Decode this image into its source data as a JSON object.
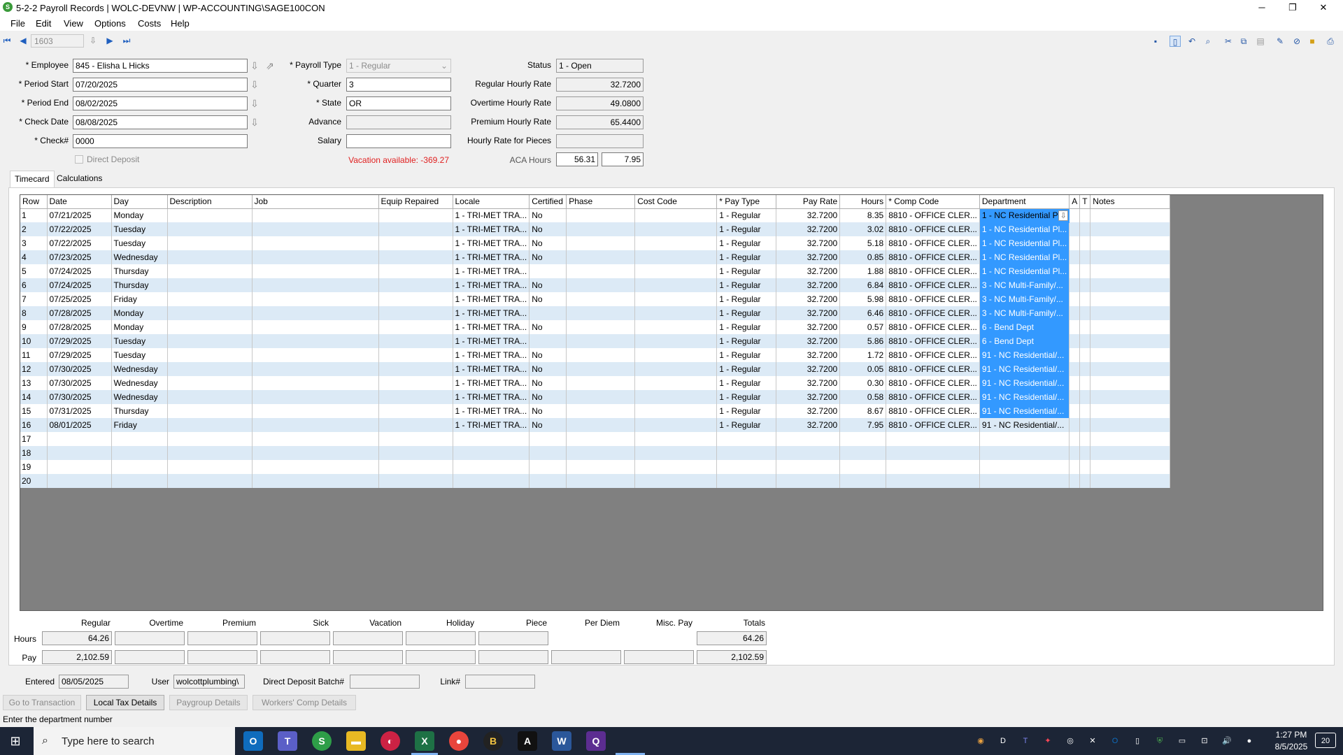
{
  "window": {
    "title": "5-2-2 Payroll Records | WOLC-DEVNW | WP-ACCOUNTING\\SAGE100CON",
    "minimize": "─",
    "maximize": "❐",
    "close": "✕"
  },
  "menu": [
    "File",
    "Edit",
    "View",
    "Options",
    "Costs",
    "Help"
  ],
  "nav": {
    "record": "1603"
  },
  "form": {
    "employee_label": "* Employee",
    "employee": "845 - Elisha L Hicks",
    "period_start_label": "* Period Start",
    "period_start": "07/20/2025",
    "period_end_label": "* Period End",
    "period_end": "08/02/2025",
    "check_date_label": "* Check Date",
    "check_date": "08/08/2025",
    "check_no_label": "* Check#",
    "check_no": "0000",
    "direct_deposit_label": "Direct Deposit",
    "payroll_type_label": "* Payroll Type",
    "payroll_type": "1 - Regular",
    "quarter_label": "* Quarter",
    "quarter": "3",
    "state_label": "* State",
    "state": "OR",
    "advance_label": "Advance",
    "advance": "",
    "salary_label": "Salary",
    "salary": "",
    "vacation_available": "Vacation available:  -369.27",
    "status_label": "Status",
    "status": "1 - Open",
    "regular_rate_label": "Regular Hourly Rate",
    "regular_rate": "32.7200",
    "overtime_rate_label": "Overtime Hourly Rate",
    "overtime_rate": "49.0800",
    "premium_rate_label": "Premium Hourly Rate",
    "premium_rate": "65.4400",
    "pieces_rate_label": "Hourly Rate for Pieces",
    "pieces_rate": "",
    "aca_label": "ACA Hours",
    "aca_1": "56.31",
    "aca_2": "7.95"
  },
  "tabs": [
    "Timecard",
    "Calculations"
  ],
  "grid": {
    "columns": [
      "Row",
      "Date",
      "Day",
      "Description",
      "Job",
      "Equip Repaired",
      "Locale",
      "Certified",
      "Phase",
      "Cost Code",
      "* Pay Type",
      "Pay Rate",
      "Hours",
      "* Comp Code",
      "Department",
      "A",
      "T",
      "Notes"
    ],
    "rows": [
      [
        "1",
        "07/21/2025",
        "Monday",
        "",
        "",
        "",
        "1 - TRI-MET TRA...",
        "No",
        "",
        "",
        "1 - Regular",
        "32.7200",
        "8.35",
        "8810 - OFFICE CLER...",
        "1 - NC Residential Pl",
        "",
        "",
        ""
      ],
      [
        "2",
        "07/22/2025",
        "Tuesday",
        "",
        "",
        "",
        "1 - TRI-MET TRA...",
        "No",
        "",
        "",
        "1 - Regular",
        "32.7200",
        "3.02",
        "8810 - OFFICE CLER...",
        "1 - NC Residential Pl...",
        "",
        "",
        ""
      ],
      [
        "3",
        "07/22/2025",
        "Tuesday",
        "",
        "",
        "",
        "1 - TRI-MET TRA...",
        "No",
        "",
        "",
        "1 - Regular",
        "32.7200",
        "5.18",
        "8810 - OFFICE CLER...",
        "1 - NC Residential Pl...",
        "",
        "",
        ""
      ],
      [
        "4",
        "07/23/2025",
        "Wednesday",
        "",
        "",
        "",
        "1 - TRI-MET TRA...",
        "No",
        "",
        "",
        "1 - Regular",
        "32.7200",
        "0.85",
        "8810 - OFFICE CLER...",
        "1 - NC Residential Pl...",
        "",
        "",
        ""
      ],
      [
        "5",
        "07/24/2025",
        "Thursday",
        "",
        "",
        "",
        "1 - TRI-MET TRA...",
        "",
        "",
        "",
        "1 - Regular",
        "32.7200",
        "1.88",
        "8810 - OFFICE CLER...",
        "1 - NC Residential Pl...",
        "",
        "",
        ""
      ],
      [
        "6",
        "07/24/2025",
        "Thursday",
        "",
        "",
        "",
        "1 - TRI-MET TRA...",
        "No",
        "",
        "",
        "1 - Regular",
        "32.7200",
        "6.84",
        "8810 - OFFICE CLER...",
        "3 - NC Multi-Family/...",
        "",
        "",
        ""
      ],
      [
        "7",
        "07/25/2025",
        "Friday",
        "",
        "",
        "",
        "1 - TRI-MET TRA...",
        "No",
        "",
        "",
        "1 - Regular",
        "32.7200",
        "5.98",
        "8810 - OFFICE CLER...",
        "3 - NC Multi-Family/...",
        "",
        "",
        ""
      ],
      [
        "8",
        "07/28/2025",
        "Monday",
        "",
        "",
        "",
        "1 - TRI-MET TRA...",
        "",
        "",
        "",
        "1 - Regular",
        "32.7200",
        "6.46",
        "8810 - OFFICE CLER...",
        "3 - NC Multi-Family/...",
        "",
        "",
        ""
      ],
      [
        "9",
        "07/28/2025",
        "Monday",
        "",
        "",
        "",
        "1 - TRI-MET TRA...",
        "No",
        "",
        "",
        "1 - Regular",
        "32.7200",
        "0.57",
        "8810 - OFFICE CLER...",
        "6 - Bend Dept",
        "",
        "",
        ""
      ],
      [
        "10",
        "07/29/2025",
        "Tuesday",
        "",
        "",
        "",
        "1 - TRI-MET TRA...",
        "",
        "",
        "",
        "1 - Regular",
        "32.7200",
        "5.86",
        "8810 - OFFICE CLER...",
        "6 - Bend Dept",
        "",
        "",
        ""
      ],
      [
        "11",
        "07/29/2025",
        "Tuesday",
        "",
        "",
        "",
        "1 - TRI-MET TRA...",
        "No",
        "",
        "",
        "1 - Regular",
        "32.7200",
        "1.72",
        "8810 - OFFICE CLER...",
        "91 - NC Residential/...",
        "",
        "",
        ""
      ],
      [
        "12",
        "07/30/2025",
        "Wednesday",
        "",
        "",
        "",
        "1 - TRI-MET TRA...",
        "No",
        "",
        "",
        "1 - Regular",
        "32.7200",
        "0.05",
        "8810 - OFFICE CLER...",
        "91 - NC Residential/...",
        "",
        "",
        ""
      ],
      [
        "13",
        "07/30/2025",
        "Wednesday",
        "",
        "",
        "",
        "1 - TRI-MET TRA...",
        "No",
        "",
        "",
        "1 - Regular",
        "32.7200",
        "0.30",
        "8810 - OFFICE CLER...",
        "91 - NC Residential/...",
        "",
        "",
        ""
      ],
      [
        "14",
        "07/30/2025",
        "Wednesday",
        "",
        "",
        "",
        "1 - TRI-MET TRA...",
        "No",
        "",
        "",
        "1 - Regular",
        "32.7200",
        "0.58",
        "8810 - OFFICE CLER...",
        "91 - NC Residential/...",
        "",
        "",
        ""
      ],
      [
        "15",
        "07/31/2025",
        "Thursday",
        "",
        "",
        "",
        "1 - TRI-MET TRA...",
        "No",
        "",
        "",
        "1 - Regular",
        "32.7200",
        "8.67",
        "8810 - OFFICE CLER...",
        "91 - NC Residential/...",
        "",
        "",
        ""
      ],
      [
        "16",
        "08/01/2025",
        "Friday",
        "",
        "",
        "",
        "1 - TRI-MET TRA...",
        "No",
        "",
        "",
        "1 - Regular",
        "32.7200",
        "7.95",
        "8810 - OFFICE CLER...",
        "91 - NC Residential/...",
        "",
        "",
        ""
      ],
      [
        "17",
        "",
        "",
        "",
        "",
        "",
        "",
        "",
        "",
        "",
        "",
        "",
        "",
        "",
        "",
        "",
        "",
        ""
      ],
      [
        "18",
        "",
        "",
        "",
        "",
        "",
        "",
        "",
        "",
        "",
        "",
        "",
        "",
        "",
        "",
        "",
        "",
        ""
      ],
      [
        "19",
        "",
        "",
        "",
        "",
        "",
        "",
        "",
        "",
        "",
        "",
        "",
        "",
        "",
        "",
        "",
        "",
        ""
      ],
      [
        "20",
        "",
        "",
        "",
        "",
        "",
        "",
        "",
        "",
        "",
        "",
        "",
        "",
        "",
        "",
        "",
        "",
        ""
      ]
    ]
  },
  "totals": {
    "headers": [
      "Regular",
      "Overtime",
      "Premium",
      "Sick",
      "Vacation",
      "Holiday",
      "Piece",
      "Per Diem",
      "Misc. Pay",
      "Totals"
    ],
    "hours_label": "Hours",
    "pay_label": "Pay",
    "hours": [
      "64.26",
      "",
      "",
      "",
      "",
      "",
      "",
      "",
      "",
      "64.26"
    ],
    "pay": [
      "2,102.59",
      "",
      "",
      "",
      "",
      "",
      "",
      "",
      "",
      "2,102.59"
    ]
  },
  "footer": {
    "entered_label": "Entered",
    "entered": "08/05/2025",
    "user_label": "User",
    "user": "wolcottplumbing\\",
    "dd_batch_label": "Direct Deposit Batch#",
    "dd_batch": "",
    "link_label": "Link#",
    "link": ""
  },
  "buttons": [
    "Go to Transaction",
    "Local Tax Details",
    "Paygroup Details",
    "Workers' Comp Details"
  ],
  "status_bar": "Enter the department number",
  "taskbar": {
    "search_placeholder": "Type here to search",
    "time": "1:27 PM",
    "date": "8/5/2025",
    "notifications": "20"
  }
}
